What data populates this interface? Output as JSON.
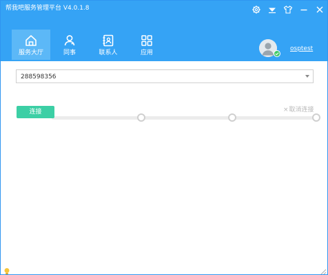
{
  "window": {
    "title": "帮我吧服务管理平台  V4.0.1.8",
    "controls": [
      {
        "name": "settings-icon"
      },
      {
        "name": "dropdown-icon"
      },
      {
        "name": "skin-icon"
      },
      {
        "name": "minimize-icon"
      },
      {
        "name": "close-icon"
      }
    ]
  },
  "nav": {
    "items": [
      {
        "label": "服务大厅",
        "icon": "home-icon",
        "active": true
      },
      {
        "label": "同事",
        "icon": "colleague-icon",
        "active": false
      },
      {
        "label": "联系人",
        "icon": "contacts-icon",
        "active": false
      },
      {
        "label": "应用",
        "icon": "apps-icon",
        "active": false
      }
    ]
  },
  "user": {
    "name": "osptest",
    "status_color": "#3fca6a"
  },
  "main": {
    "device_select": {
      "value": "288598356"
    },
    "connect_button": "连接",
    "cancel_link": "取消连接",
    "progress": {
      "steps": 4,
      "completed": 0
    }
  },
  "colors": {
    "header": "#35a3f5",
    "active_tab": "#5cb8f7",
    "accent": "#3ccfa5"
  }
}
